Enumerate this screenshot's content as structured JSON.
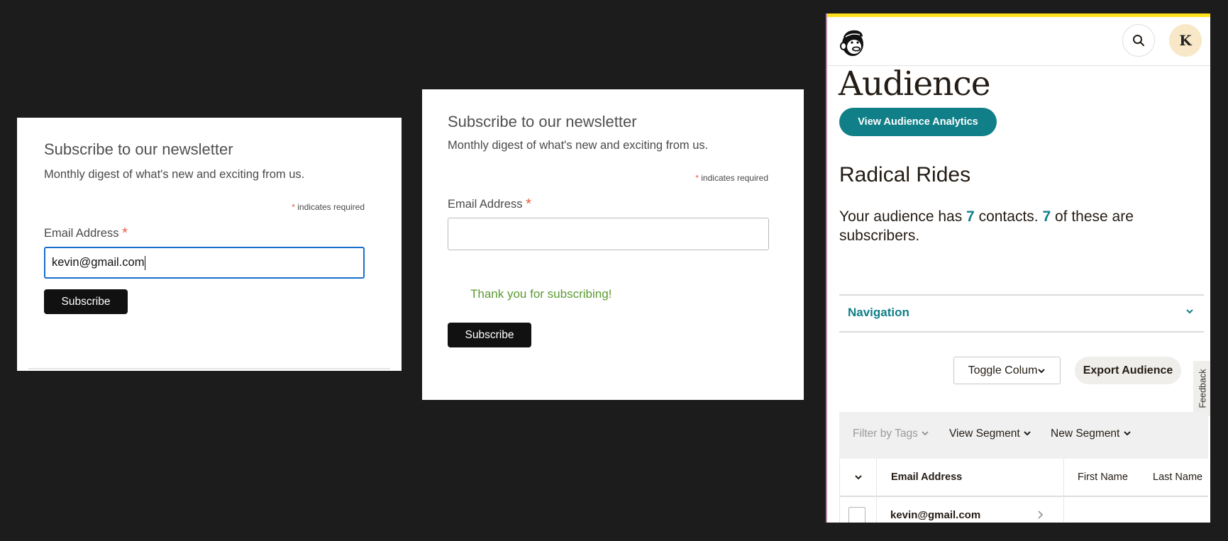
{
  "form_filled": {
    "title": "Subscribe to our newsletter",
    "subtitle": "Monthly digest of what's new and exciting from us.",
    "required_star": "*",
    "required_note": "indicates required",
    "email_label": "Email Address",
    "email_value": "kevin@gmail.com",
    "subscribe_label": "Subscribe"
  },
  "form_submitted": {
    "title": "Subscribe to our newsletter",
    "subtitle": "Monthly digest of what's new and exciting from us.",
    "required_star": "*",
    "required_note": "indicates required",
    "email_label": "Email Address",
    "email_value": "",
    "success_message": "Thank you for subscribing!",
    "subscribe_label": "Subscribe"
  },
  "mailchimp": {
    "accent_color": "#107f88",
    "brand_bar_color": "#ffe01b",
    "logo_icon": "mailchimp-freddie-logo",
    "search_icon": "search-icon",
    "avatar_initial": "K",
    "page_title": "Audience",
    "analytics_button": "View Audience Analytics",
    "audience_name": "Radical Rides",
    "summary": {
      "prefix": "Your audience has ",
      "contacts": "7",
      "middle": " contacts. ",
      "subscribers": "7",
      "suffix": " of these are subscribers."
    },
    "navigation_label": "Navigation",
    "toggle_columns": "Toggle Colum",
    "export_audience": "Export Audience",
    "feedback": "Feedback",
    "filters": [
      {
        "label": "Filter by Tags",
        "disabled": true
      },
      {
        "label": "View Segment",
        "disabled": false
      },
      {
        "label": "New Segment",
        "disabled": false
      }
    ],
    "table": {
      "columns": [
        "Email Address",
        "First Name",
        "Last Name"
      ],
      "rows": [
        {
          "email": "kevin@gmail.com",
          "first_name": "",
          "last_name": ""
        }
      ]
    }
  }
}
